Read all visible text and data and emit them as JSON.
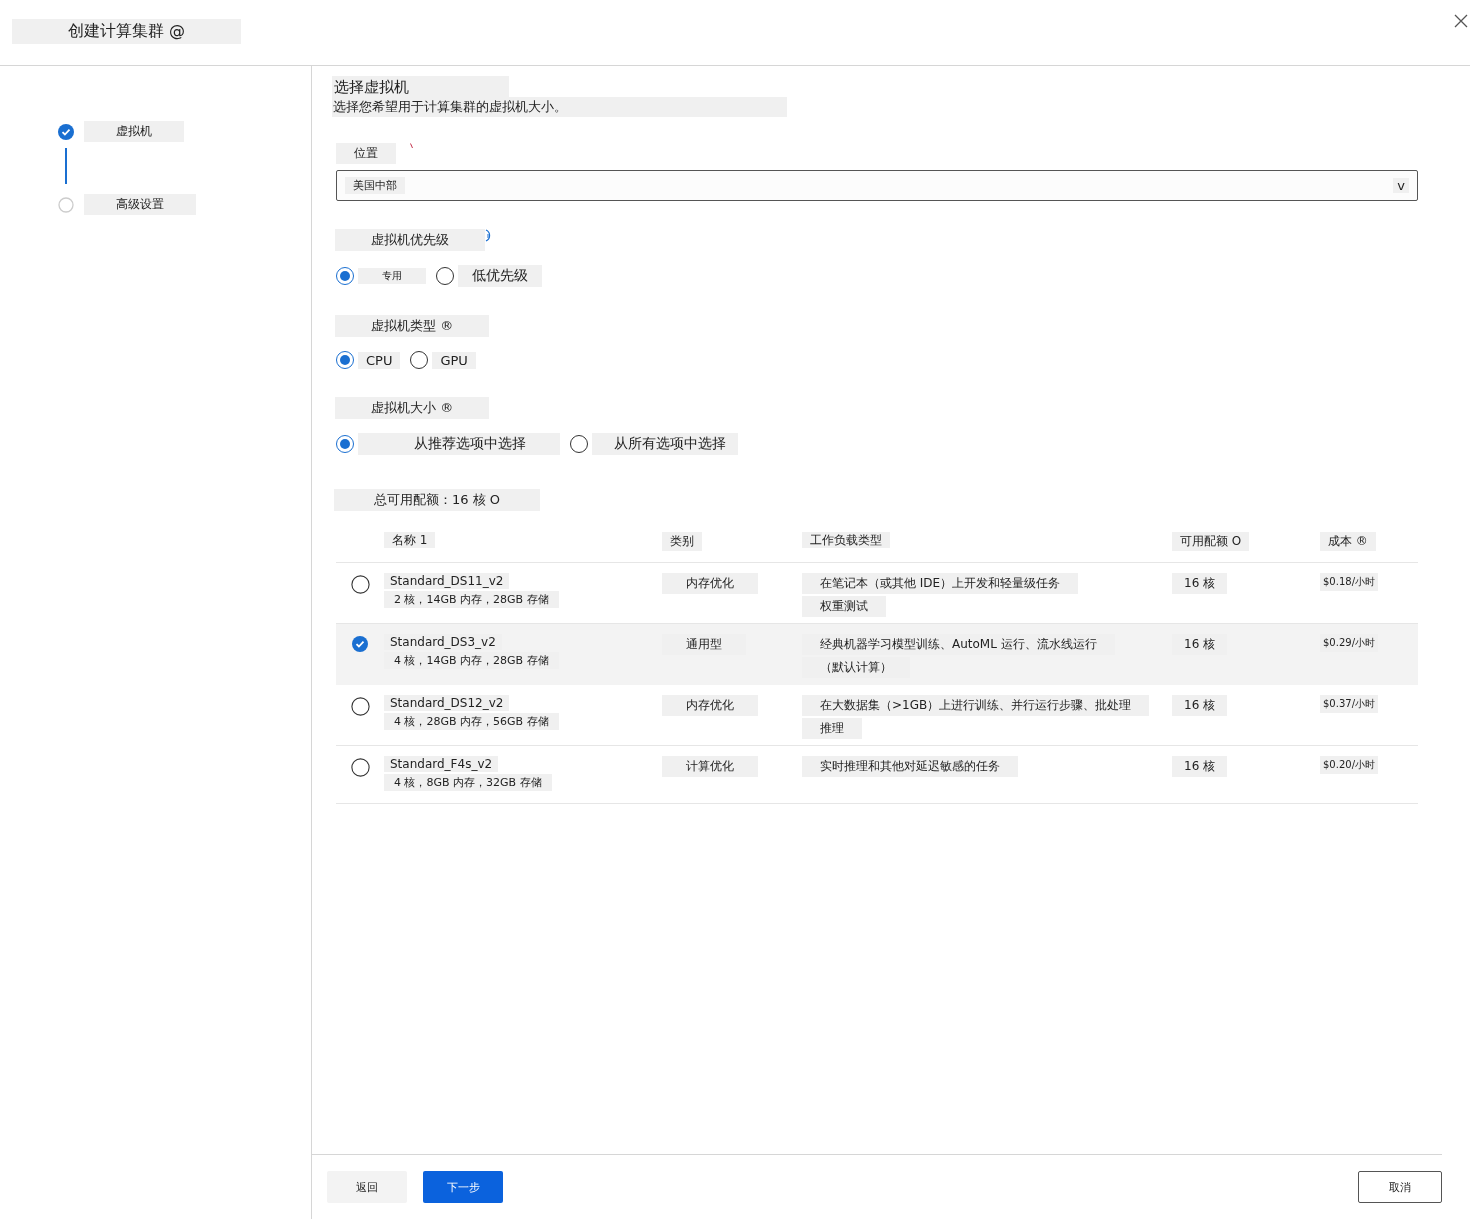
{
  "window": {
    "title": "创建计算集群 @"
  },
  "steps": [
    {
      "label": "虚拟机",
      "done": true
    },
    {
      "label": "高级设置",
      "done": false
    }
  ],
  "heading": "选择虚拟机",
  "subtitle": "选择您希望用于计算集群的虚拟机大小。",
  "location": {
    "label": "位置",
    "required": true,
    "value": "美国中部",
    "caret": "v"
  },
  "priority": {
    "label": "虚拟机优先级",
    "info": true,
    "options": [
      {
        "label": "专用",
        "selected": true
      },
      {
        "label": "低优先级",
        "selected": false
      }
    ]
  },
  "vm_type": {
    "label": "虚拟机类型 ®",
    "options": [
      {
        "label": "CPU",
        "selected": true
      },
      {
        "label": "GPU",
        "selected": false
      }
    ]
  },
  "vm_size": {
    "label": "虚拟机大小 ®",
    "options": [
      {
        "label": "从推荐选项中选择",
        "selected": true
      },
      {
        "label": "从所有选项中选择",
        "selected": false
      }
    ]
  },
  "quota": "总可用配额：16 核 O",
  "table": {
    "columns": [
      "名称 1",
      "类别",
      "工作负载类型",
      "可用配额 O",
      "成本 ®"
    ],
    "rows": [
      {
        "selected": false,
        "name": "Standard_DS11_v2",
        "specs": "2 核，14GB 内存，28GB 存储",
        "category": "内存优化",
        "workload": [
          "在笔记本（或其他 IDE）上开发和轻量级任务",
          "权重测试"
        ],
        "quota": "16 核",
        "cost": "$0.18/小时"
      },
      {
        "selected": true,
        "name": "Standard_DS3_v2",
        "specs": "4 核，14GB 内存，28GB 存储",
        "category": "通用型",
        "workload": [
          "经典机器学习模型训练、AutoML 运行、流水线运行",
          "（默认计算）"
        ],
        "quota": "16 核",
        "cost": "$0.29/小时"
      },
      {
        "selected": false,
        "name": "Standard_DS12_v2",
        "specs": "4 核，28GB 内存，56GB 存储",
        "category": "内存优化",
        "workload": [
          "在大数据集（>1GB）上进行训练、并行运行步骤、批处理",
          "推理"
        ],
        "quota": "16 核",
        "cost": "$0.37/小时"
      },
      {
        "selected": false,
        "name": "Standard_F4s_v2",
        "specs": "4 核，8GB 内存，32GB 存储",
        "category": "计算优化",
        "workload": [
          "实时推理和其他对延迟敏感的任务"
        ],
        "quota": "16 核",
        "cost": "$0.20/小时"
      }
    ]
  },
  "buttons": {
    "back": "返回",
    "next": "下一步",
    "cancel": "取消"
  }
}
